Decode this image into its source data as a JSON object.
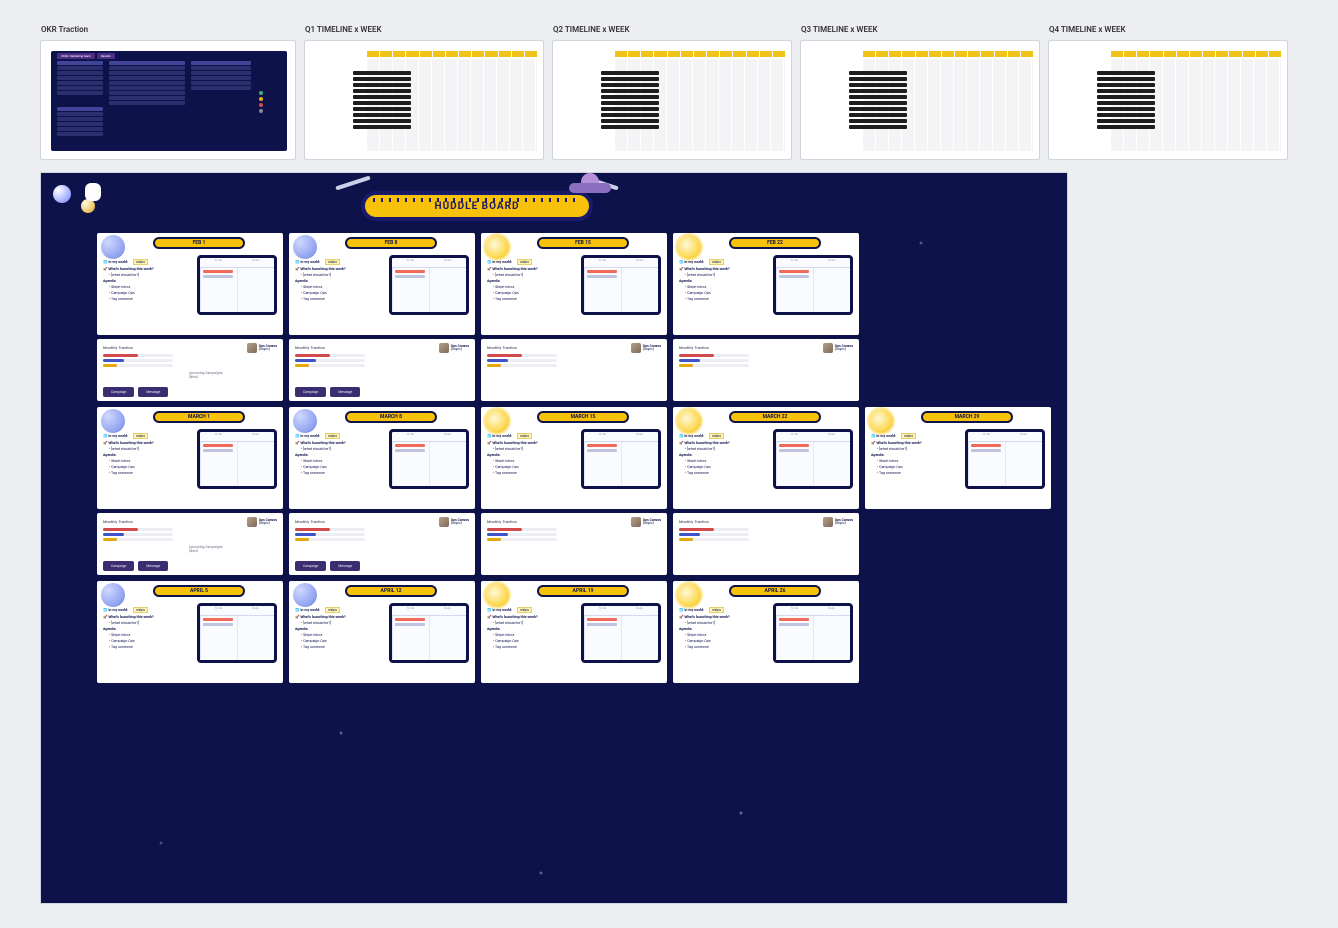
{
  "frames": {
    "okr": {
      "title": "OKR Traction"
    },
    "timelines": [
      {
        "title": "Q1 TIMELINE x WEEK"
      },
      {
        "title": "Q2 TIMELINE x WEEK"
      },
      {
        "title": "Q3 TIMELINE x WEEK"
      },
      {
        "title": "Q4 TIMELINE x WEEK"
      }
    ]
  },
  "okr_tabs": [
    "OKRs: Marketing team",
    "Results"
  ],
  "okr_legend_colors": [
    "#3bb273",
    "#e5a90c",
    "#d24a4a",
    "#888"
  ],
  "huddle_board_title": "HUDDLE BOARD",
  "agenda_template": {
    "world_label": "In my world:",
    "world_sticky": "status",
    "launch_label": "What's launching this week?",
    "launch_sub": "[what should be?]",
    "agenda_label": "Agenda:",
    "agenda_items": [
      "Steph intros",
      "Campaign Ops",
      "Tag someone"
    ]
  },
  "traction_template": {
    "title": "Monthly Traction",
    "owner_name": "Ops Convos",
    "owner_sub": "[Async]",
    "upcoming_label": "Upcoming Campaigns:",
    "upcoming_sub": "[links]",
    "buttons": [
      "Campaign",
      "Message"
    ]
  },
  "weeks": [
    {
      "date": "FEB 1",
      "icon": "planet",
      "traction": "full"
    },
    {
      "date": "FEB 8",
      "icon": "planet",
      "traction": "btns"
    },
    {
      "date": "FEB 15",
      "icon": "sun",
      "traction": "bars"
    },
    {
      "date": "FEB 22",
      "icon": "sun",
      "traction": "bars"
    },
    null,
    {
      "date": "MARCH 1",
      "icon": "planet",
      "traction": "full"
    },
    {
      "date": "MARCH 8",
      "icon": "planet",
      "traction": "btns"
    },
    {
      "date": "MARCH 15",
      "icon": "sun",
      "traction": "bars"
    },
    {
      "date": "MARCH 22",
      "icon": "sun",
      "traction": "bars"
    },
    {
      "date": "MARCH 29",
      "icon": "sun",
      "traction": null
    },
    {
      "date": "APRIL 5",
      "icon": "planet",
      "traction": null
    },
    {
      "date": "APRIL 12",
      "icon": "planet",
      "traction": null
    },
    {
      "date": "APRIL 19",
      "icon": "sun",
      "traction": null
    },
    {
      "date": "APRIL 26",
      "icon": "sun",
      "traction": null
    },
    null
  ]
}
